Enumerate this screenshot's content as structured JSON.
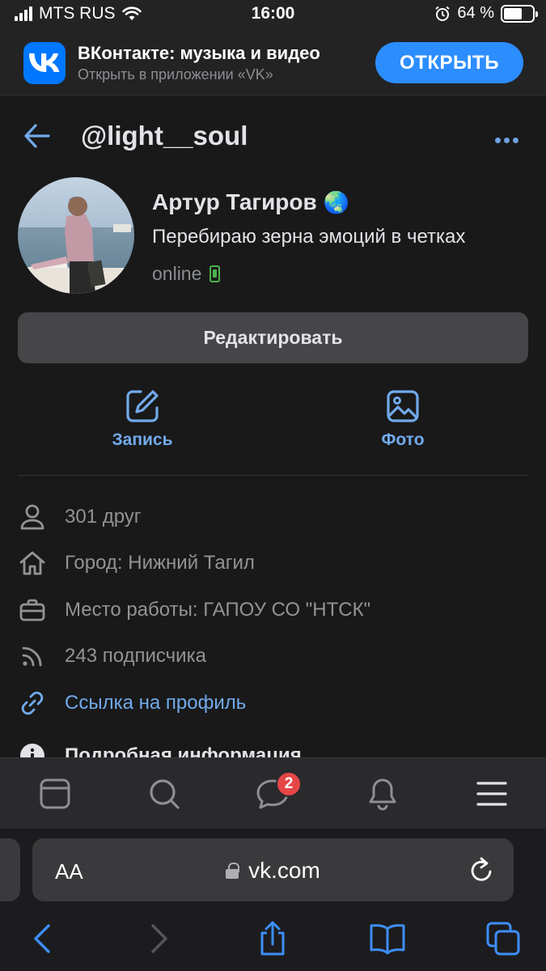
{
  "status_bar": {
    "carrier": "MTS RUS",
    "time": "16:00",
    "battery_percent": "64 %",
    "battery_level": 0.64
  },
  "app_banner": {
    "title": "ВКонтакте: музыка и видео",
    "subtitle": "Открыть в приложении «VK»",
    "open_label": "ОТКРЫТЬ",
    "logo_icon": "vk-logo",
    "accent_color": "#2c8dff"
  },
  "header": {
    "title": "@light__soul",
    "back_icon": "back-arrow-icon",
    "more_icon": "more-icon"
  },
  "profile": {
    "name": "Артур Тагиров",
    "name_emoji": "🌏",
    "status": "Перебираю зерна эмоций в четках",
    "online": "online",
    "edit_label": "Редактировать"
  },
  "actions": [
    {
      "label": "Запись",
      "icon": "edit-icon"
    },
    {
      "label": "Фото",
      "icon": "image-icon"
    }
  ],
  "info": {
    "friends": "301 друг",
    "city": "Город: Нижний Тагил",
    "work": "Место работы: ГАПОУ СО \"НТСК\"",
    "followers": "243 подписчика",
    "profile_link": "Ссылка на профиль",
    "details": "Подробная информация"
  },
  "web_tabbar": {
    "items": [
      "home-icon",
      "search-icon",
      "messages-icon",
      "bell-icon",
      "menu-icon"
    ],
    "messages_badge": "2"
  },
  "safari": {
    "aa_label": "AA",
    "url": "vk.com"
  }
}
